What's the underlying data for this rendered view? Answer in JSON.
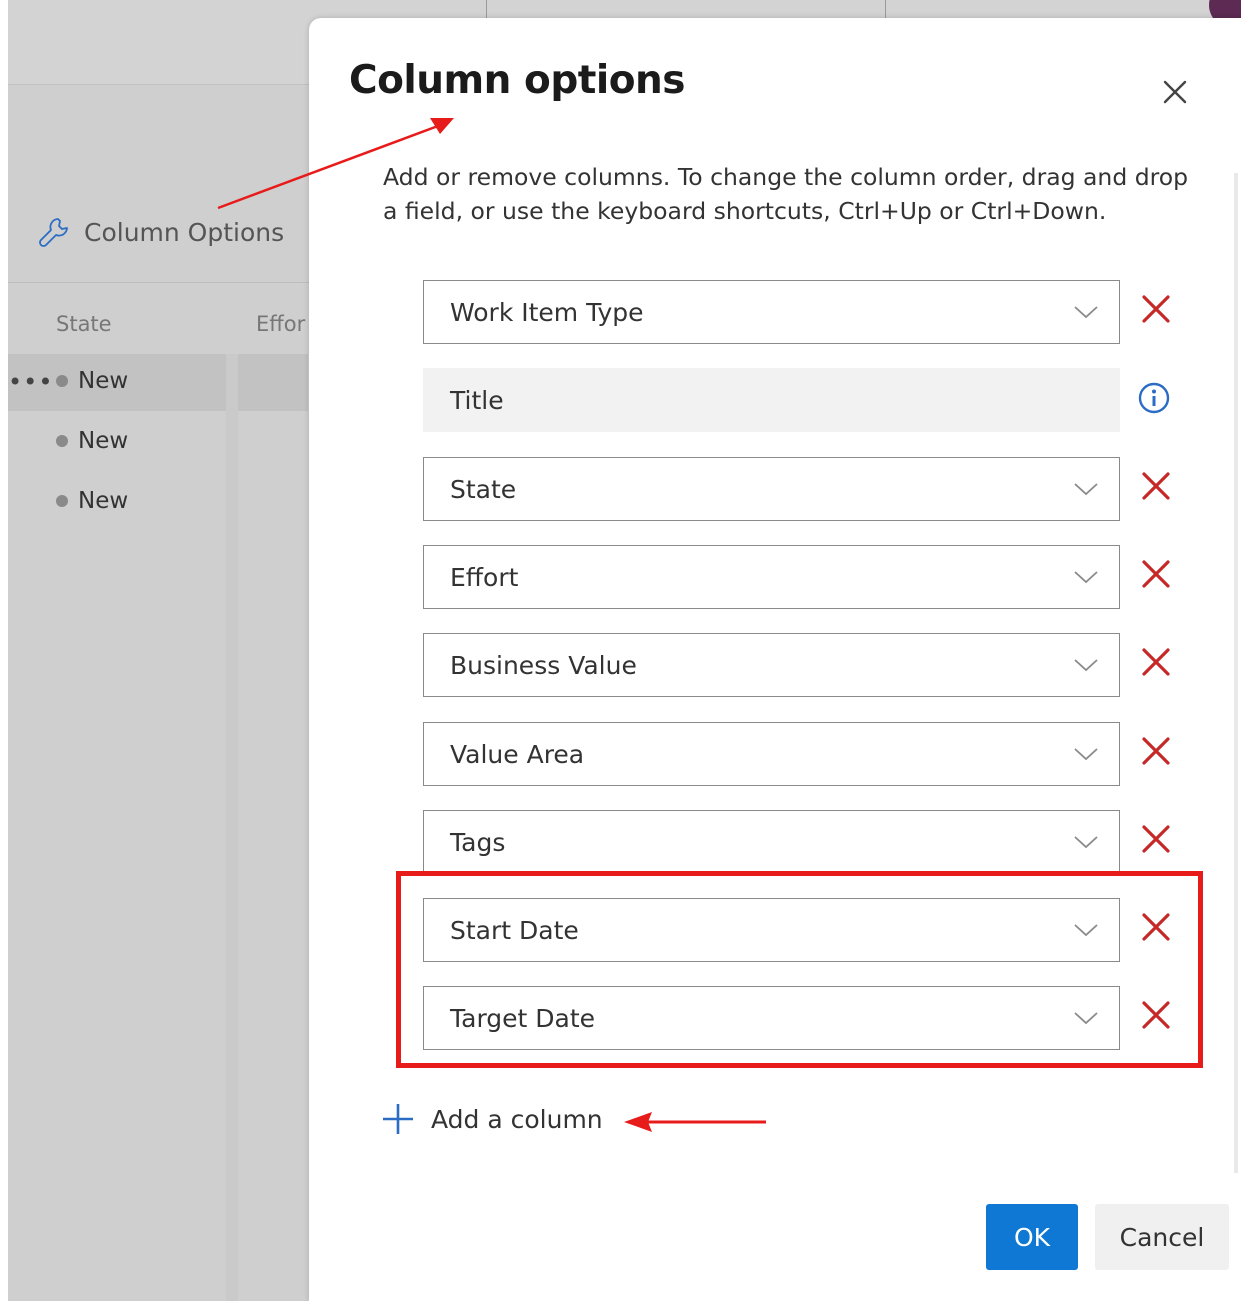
{
  "background": {
    "toolbar_button": {
      "icon": "wrench-icon",
      "label": "Column Options"
    },
    "columns": [
      "State",
      "Effor"
    ],
    "rows": [
      {
        "state": "New"
      },
      {
        "state": "New"
      },
      {
        "state": "New"
      }
    ],
    "more_glyph": "•••"
  },
  "dialog": {
    "title": "Column options",
    "close_icon": "close-icon",
    "description": "Add or remove columns. To change the column order, drag and drop a field, or use the keyboard shortcuts, Ctrl+Up or Ctrl+Down.",
    "fields": [
      {
        "label": "Work Item Type",
        "removable": true
      },
      {
        "label": "Title",
        "removable": false,
        "icon": "info-icon"
      },
      {
        "label": "State",
        "removable": true
      },
      {
        "label": "Effort",
        "removable": true
      },
      {
        "label": "Business Value",
        "removable": true
      },
      {
        "label": "Value Area",
        "removable": true
      },
      {
        "label": "Tags",
        "removable": true
      },
      {
        "label": "Start Date",
        "removable": true
      },
      {
        "label": "Target Date",
        "removable": true
      }
    ],
    "add_column_label": "Add a column",
    "ok_label": "OK",
    "cancel_label": "Cancel"
  },
  "colors": {
    "accent": "#0f78d4",
    "remove": "#c62828",
    "annotation": "#e81b1b"
  }
}
